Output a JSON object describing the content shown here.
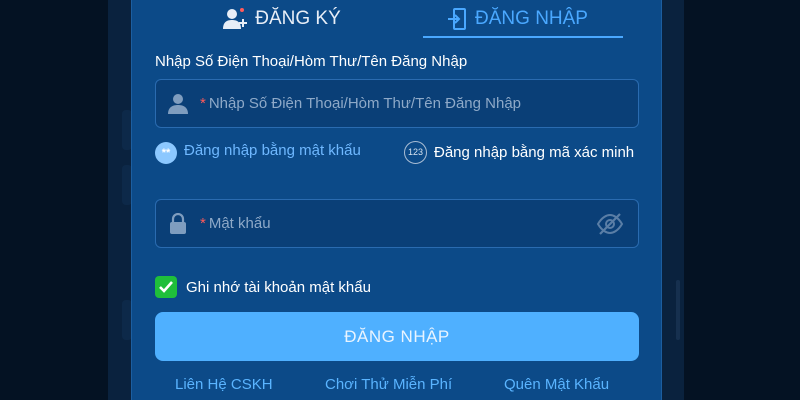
{
  "tabs": {
    "register": {
      "label": "ĐĂNG KÝ",
      "icon": "add-user-icon"
    },
    "login": {
      "label": "ĐĂNG NHẬP",
      "icon": "login-door-icon",
      "active": true
    }
  },
  "form": {
    "username_label": "Nhập Số Điện Thoại/Hòm Thư/Tên Đăng Nhập",
    "username_required": "*",
    "username_placeholder": "Nhập Số Điện Thoại/Hòm Thư/Tên Đăng Nhập",
    "method_password": {
      "label": "Đăng nhập bằng mật khẩu",
      "badge": "**",
      "selected": true
    },
    "method_code": {
      "label": "Đăng nhập bằng mã xác minh",
      "badge": "123"
    },
    "password_required": "*",
    "password_placeholder": "Mật khẩu",
    "remember_label": "Ghi nhớ tài khoản mật khẩu",
    "remember_checked": true,
    "submit_label": "ĐĂNG NHẬP"
  },
  "footer": {
    "support": "Liên Hệ CSKH",
    "trial": "Chơi Thử Miễn Phí",
    "forgot": "Quên Mật Khẩu"
  },
  "colors": {
    "modal_bg": "#0c4a88",
    "accent": "#4aa8ff",
    "button": "#4fb0ff",
    "check": "#1fbf3a",
    "required": "#ff5a5a"
  }
}
